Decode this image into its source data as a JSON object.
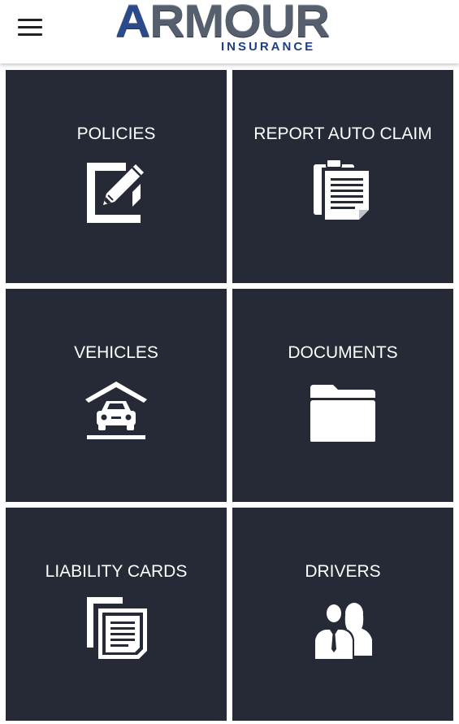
{
  "header": {
    "menu_icon": "hamburger-menu-icon",
    "logo": {
      "word": "ARMOUR",
      "subtitle": "INSURANCE"
    }
  },
  "tiles": [
    {
      "label": "POLICIES",
      "icon": "edit-document-icon"
    },
    {
      "label": "REPORT AUTO CLAIM",
      "icon": "clipboard-icon"
    },
    {
      "label": "VEHICLES",
      "icon": "car-garage-icon"
    },
    {
      "label": "DOCUMENTS",
      "icon": "folder-icon"
    },
    {
      "label": "LIABILITY CARDS",
      "icon": "copy-documents-icon"
    },
    {
      "label": "DRIVERS",
      "icon": "people-icon"
    }
  ],
  "colors": {
    "tile_background": "#262a36",
    "tile_text": "#ffffff",
    "logo_blue": "#1f3e84",
    "logo_gray": "#555f6e"
  }
}
